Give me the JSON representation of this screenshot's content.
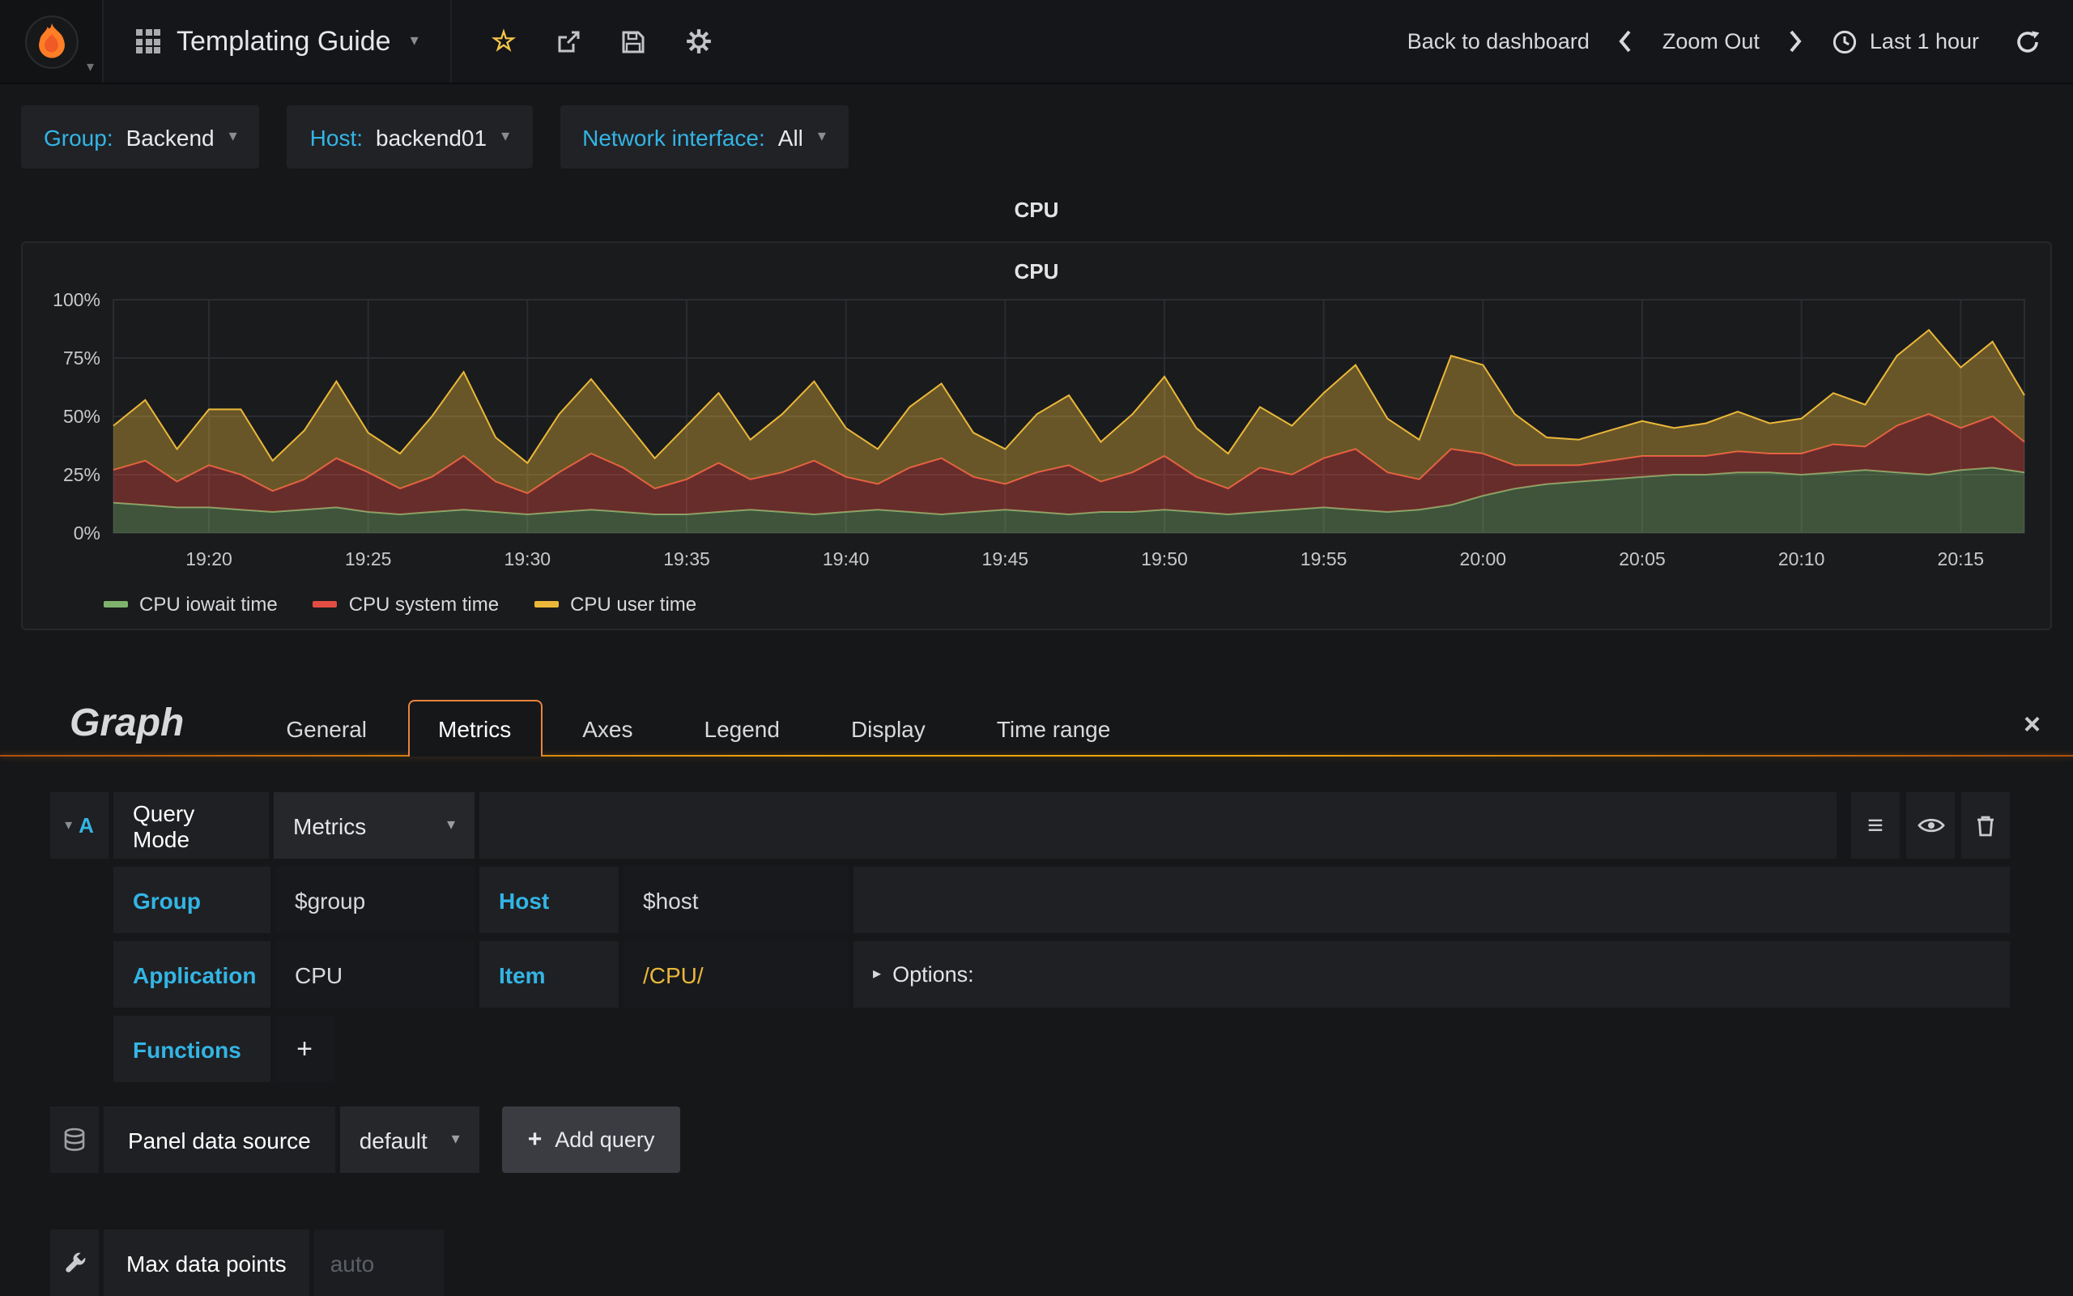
{
  "navbar": {
    "title": "Templating Guide",
    "back_to_dashboard": "Back to dashboard",
    "zoom_out": "Zoom Out",
    "time_range": "Last 1 hour"
  },
  "variables": [
    {
      "label": "Group:",
      "value": "Backend"
    },
    {
      "label": "Host:",
      "value": "backend01"
    },
    {
      "label": "Network interface:",
      "value": "All"
    }
  ],
  "panel": {
    "title": "CPU",
    "chart_title": "CPU"
  },
  "chart_data": {
    "type": "area",
    "stacked": true,
    "title": "CPU",
    "ylabel": "",
    "xlabel": "",
    "ylim": [
      0,
      100
    ],
    "y_ticks": [
      0,
      25,
      50,
      75,
      100
    ],
    "y_tick_suffix": "%",
    "grid": true,
    "legend_position": "bottom-left",
    "x_tick_labels": [
      "19:20",
      "19:25",
      "19:30",
      "19:35",
      "19:40",
      "19:45",
      "19:50",
      "19:55",
      "20:00",
      "20:05",
      "20:10",
      "20:15"
    ],
    "x_tick_index": [
      3,
      8,
      13,
      18,
      23,
      28,
      33,
      38,
      43,
      48,
      53,
      58
    ],
    "series": [
      {
        "name": "CPU iowait time",
        "color": "#7EB26D",
        "values": [
          13,
          12,
          11,
          11,
          10,
          9,
          10,
          11,
          9,
          8,
          9,
          10,
          9,
          8,
          9,
          10,
          9,
          8,
          8,
          9,
          10,
          9,
          8,
          9,
          10,
          9,
          8,
          9,
          10,
          9,
          8,
          9,
          9,
          10,
          9,
          8,
          9,
          10,
          11,
          10,
          9,
          10,
          12,
          16,
          19,
          21,
          22,
          23,
          24,
          25,
          25,
          26,
          26,
          25,
          26,
          27,
          26,
          25,
          27,
          28,
          26
        ]
      },
      {
        "name": "CPU system time",
        "color": "#E24D42",
        "values": [
          14,
          19,
          11,
          18,
          15,
          9,
          13,
          21,
          17,
          11,
          15,
          23,
          13,
          9,
          17,
          24,
          19,
          11,
          15,
          21,
          13,
          17,
          23,
          15,
          11,
          19,
          24,
          15,
          11,
          17,
          21,
          13,
          17,
          23,
          15,
          11,
          19,
          15,
          21,
          26,
          17,
          13,
          24,
          18,
          10,
          8,
          7,
          8,
          9,
          8,
          8,
          9,
          8,
          9,
          12,
          10,
          20,
          26,
          18,
          22,
          13
        ]
      },
      {
        "name": "CPU user time",
        "color": "#EAB839",
        "values": [
          19,
          26,
          14,
          24,
          28,
          13,
          21,
          33,
          17,
          15,
          26,
          36,
          19,
          13,
          25,
          32,
          21,
          13,
          23,
          30,
          17,
          25,
          34,
          21,
          15,
          26,
          32,
          19,
          15,
          25,
          30,
          17,
          25,
          34,
          21,
          15,
          26,
          21,
          28,
          36,
          23,
          17,
          40,
          38,
          22,
          12,
          11,
          13,
          15,
          12,
          14,
          17,
          13,
          15,
          22,
          18,
          30,
          36,
          26,
          32,
          20
        ]
      }
    ]
  },
  "editor": {
    "panel_type": "Graph",
    "tabs": [
      "General",
      "Metrics",
      "Axes",
      "Legend",
      "Display",
      "Time range"
    ],
    "active_tab": "Metrics",
    "query": {
      "letter": "A",
      "mode_label": "Query Mode",
      "mode_value": "Metrics",
      "group_label": "Group",
      "group_value": "$group",
      "host_label": "Host",
      "host_value": "$host",
      "application_label": "Application",
      "application_value": "CPU",
      "item_label": "Item",
      "item_value": "/CPU/",
      "options_label": "Options:",
      "functions_label": "Functions"
    },
    "datasource": {
      "label": "Panel data source",
      "value": "default",
      "add_query": "Add query"
    },
    "max_data_points": {
      "label": "Max data points",
      "placeholder": "auto"
    }
  },
  "icons": {
    "caret_down": "▾",
    "caret_right": "▸",
    "star": "☆",
    "menu": "≡",
    "plus": "+",
    "close": "×"
  },
  "colors": {
    "accent_blue": "#33b5e5",
    "tab_active_border": "#e9833e",
    "item_value_orange": "#eab839"
  }
}
